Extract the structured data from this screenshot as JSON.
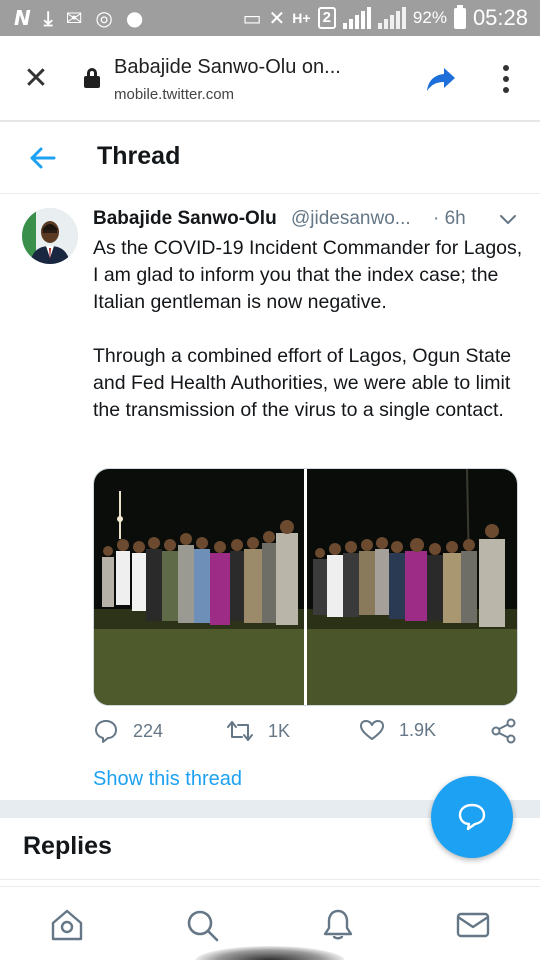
{
  "status_bar": {
    "battery": "92%",
    "time": "05:28",
    "network_label": "H+",
    "sim_label": "2",
    "icons": [
      "n-app-icon",
      "download-icon",
      "mail-icon",
      "whatsapp-icon",
      "app-icon",
      "cast-icon",
      "mute-icon",
      "signal-icon",
      "battery-icon"
    ]
  },
  "browser": {
    "title": "Babajide Sanwo-Olu on...",
    "domain": "mobile.twitter.com"
  },
  "header": {
    "title": "Thread"
  },
  "tweet": {
    "author_name": "Babajide Sanwo-Olu",
    "handle": "@jidesanwo...",
    "time": "· 6h",
    "paragraph1": "As the COVID-19 Incident Commander for Lagos, I am glad to inform you that the index case; the Italian gentleman is now negative.",
    "paragraph2": "Through a combined effort of Lagos, Ogun State and Fed Health Authorities, we were able to limit the transmission of the virus to a single contact.",
    "replies": "224",
    "retweets": "1K",
    "likes": "1.9K",
    "show_thread": "Show this thread"
  },
  "replies_section": {
    "title": "Replies"
  },
  "bottom_nav": {
    "items": [
      "home-icon",
      "search-icon",
      "notifications-icon",
      "messages-icon"
    ]
  },
  "colors": {
    "accent": "#1da1f2",
    "status_bar": "#9e9e9e",
    "secondary_text": "#657786"
  }
}
